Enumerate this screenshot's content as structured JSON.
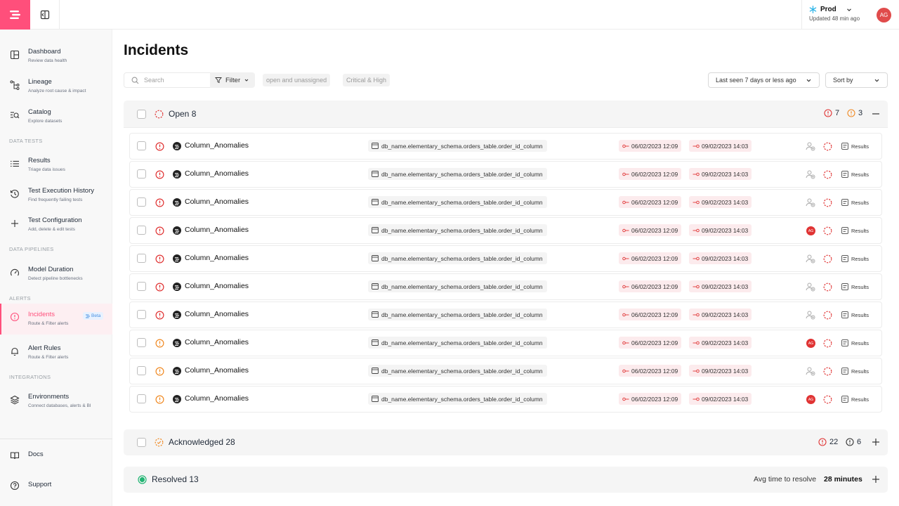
{
  "topbar": {
    "env_name": "Prod",
    "env_updated": "Updated 48 min ago",
    "avatar_initials": "AG"
  },
  "sidebar": {
    "items": [
      {
        "label": "Dashboard",
        "sub": "Review data health"
      },
      {
        "label": "Lineage",
        "sub": "Analyze root cause & impact"
      },
      {
        "label": "Catalog",
        "sub": "Explore datasets"
      },
      {
        "label": "Results",
        "sub": "Triage data issues"
      },
      {
        "label": "Test Execution History",
        "sub": "Find frequently failing tests"
      },
      {
        "label": "Test Configuration",
        "sub": "Add, delete & edit tests"
      },
      {
        "label": "Model Duration",
        "sub": "Detect pipeline bottlenecks"
      },
      {
        "label": "Incidents",
        "sub": "Route & Filter alerts",
        "badge": "Beta"
      },
      {
        "label": "Alert Rules",
        "sub": "Route & Filter alerts"
      },
      {
        "label": "Environments",
        "sub": "Connect databases, alerts & BI"
      },
      {
        "label": "Docs"
      },
      {
        "label": "Support"
      }
    ],
    "sections": [
      "DATA TESTS",
      "DATA PIPELINES",
      "ALERTS",
      "INTEGRATIONS"
    ]
  },
  "main": {
    "title": "Incidents",
    "search_placeholder": "Search",
    "filter_label": "Filter",
    "chips": [
      "open and unassigned",
      "Critical & High"
    ],
    "time_filter": "Last seen 7 days or less ago",
    "sort_label": "Sort by"
  },
  "groups": {
    "open": {
      "title": "Open 8",
      "count_critical": "7",
      "count_high": "3"
    },
    "acknowledged": {
      "title": "Acknowledged 28",
      "count_critical": "22",
      "count_other": "6"
    },
    "resolved": {
      "title": "Resolved 13",
      "avg_label": "Avg time to resolve",
      "avg_value": "28 minutes"
    }
  },
  "incidents": [
    {
      "severity": "critical",
      "name": "Column_Anomalies",
      "table": "db_name.elementary_schema.orders_table.order_id_column",
      "first_seen": "06/02/2023 12:09",
      "last_seen": "09/02/2023 14:03",
      "assignee": "",
      "results_label": "Results"
    },
    {
      "severity": "critical",
      "name": "Column_Anomalies",
      "table": "db_name.elementary_schema.orders_table.order_id_column",
      "first_seen": "06/02/2023 12:09",
      "last_seen": "09/02/2023 14:03",
      "assignee": "",
      "results_label": "Results"
    },
    {
      "severity": "critical",
      "name": "Column_Anomalies",
      "table": "db_name.elementary_schema.orders_table.order_id_column",
      "first_seen": "06/02/2023 12:09",
      "last_seen": "09/02/2023 14:03",
      "assignee": "",
      "results_label": "Results"
    },
    {
      "severity": "critical",
      "name": "Column_Anomalies",
      "table": "db_name.elementary_schema.orders_table.order_id_column",
      "first_seen": "06/02/2023 12:09",
      "last_seen": "09/02/2023 14:03",
      "assignee": "AG",
      "results_label": "Results"
    },
    {
      "severity": "critical",
      "name": "Column_Anomalies",
      "table": "db_name.elementary_schema.orders_table.order_id_column",
      "first_seen": "06/02/2023 12:09",
      "last_seen": "09/02/2023 14:03",
      "assignee": "",
      "results_label": "Results"
    },
    {
      "severity": "critical",
      "name": "Column_Anomalies",
      "table": "db_name.elementary_schema.orders_table.order_id_column",
      "first_seen": "06/02/2023 12:09",
      "last_seen": "09/02/2023 14:03",
      "assignee": "",
      "results_label": "Results"
    },
    {
      "severity": "critical",
      "name": "Column_Anomalies",
      "table": "db_name.elementary_schema.orders_table.order_id_column",
      "first_seen": "06/02/2023 12:09",
      "last_seen": "09/02/2023 14:03",
      "assignee": "",
      "results_label": "Results"
    },
    {
      "severity": "high",
      "name": "Column_Anomalies",
      "table": "db_name.elementary_schema.orders_table.order_id_column",
      "first_seen": "06/02/2023 12:09",
      "last_seen": "09/02/2023 14:03",
      "assignee": "AG",
      "results_label": "Results"
    },
    {
      "severity": "high",
      "name": "Column_Anomalies",
      "table": "db_name.elementary_schema.orders_table.order_id_column",
      "first_seen": "06/02/2023 12:09",
      "last_seen": "09/02/2023 14:03",
      "assignee": "",
      "results_label": "Results"
    },
    {
      "severity": "high",
      "name": "Column_Anomalies",
      "table": "db_name.elementary_schema.orders_table.order_id_column",
      "first_seen": "06/02/2023 12:09",
      "last_seen": "09/02/2023 14:03",
      "assignee": "AG",
      "results_label": "Results"
    }
  ],
  "colors": {
    "brand": "#ff4f7b",
    "critical": "#e03333",
    "high": "#f08a24",
    "resolved": "#22b573"
  }
}
